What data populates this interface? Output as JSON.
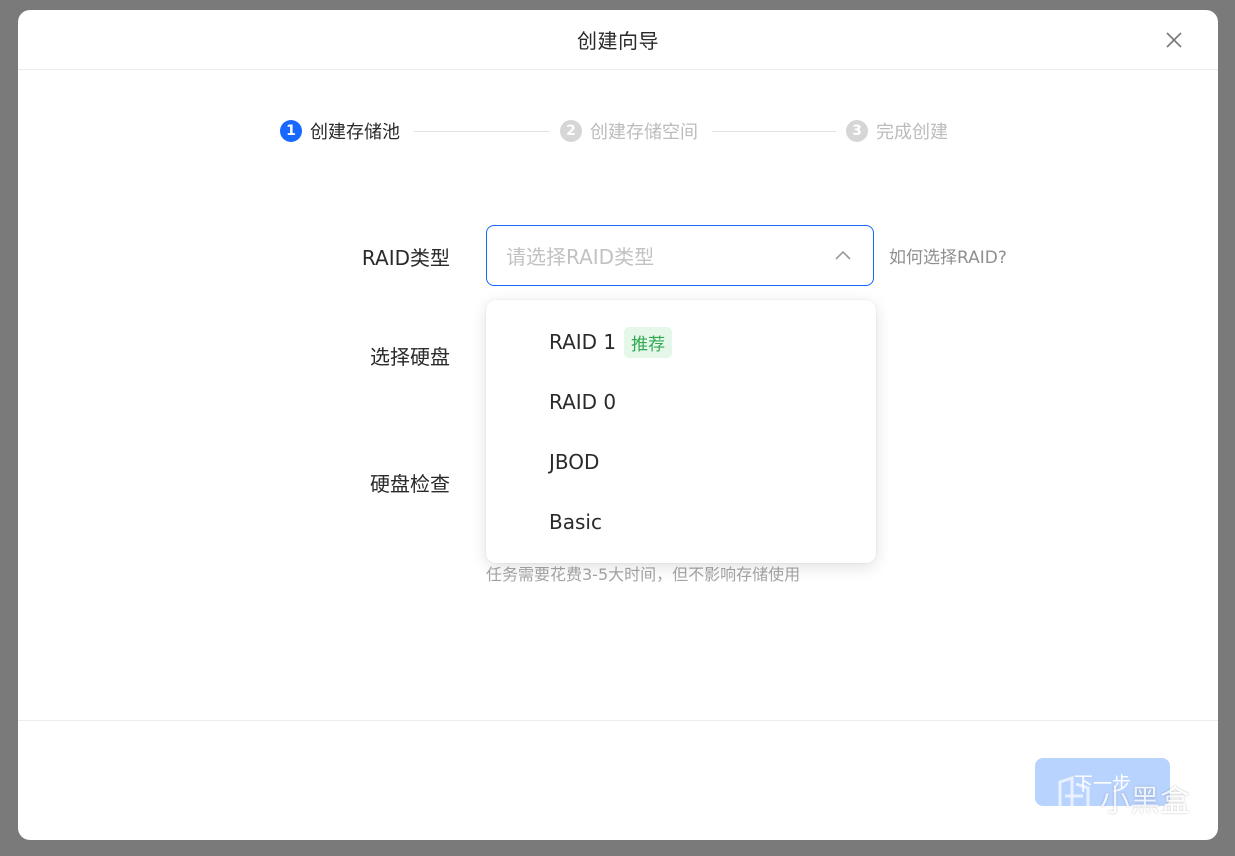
{
  "dialog": {
    "title": "创建向导",
    "close_icon": "close-icon"
  },
  "steps": [
    {
      "number": "1",
      "label": "创建存储池",
      "state": "active"
    },
    {
      "number": "2",
      "label": "创建存储空间",
      "state": "inactive"
    },
    {
      "number": "3",
      "label": "完成创建",
      "state": "inactive"
    }
  ],
  "form": {
    "raid_type_label": "RAID类型",
    "raid_type_placeholder": "请选择RAID类型",
    "help_link": "如何选择RAID?",
    "select_disk_label": "选择硬盘",
    "disk_check_label": "硬盘检查",
    "disk_check_hint": "任务需要花费3-5大时间，但不影响存储使用"
  },
  "dropdown": {
    "options": [
      {
        "label": "RAID 1",
        "badge": "推荐"
      },
      {
        "label": "RAID 0"
      },
      {
        "label": "JBOD"
      },
      {
        "label": "Basic"
      }
    ]
  },
  "footer": {
    "next_label": "下一步"
  },
  "watermark": {
    "text": "小黑盒"
  },
  "colors": {
    "accent": "#1668ff",
    "badge_bg": "#e4f7e9",
    "badge_text": "#33a852",
    "disabled_button": "#b9d3ff"
  }
}
